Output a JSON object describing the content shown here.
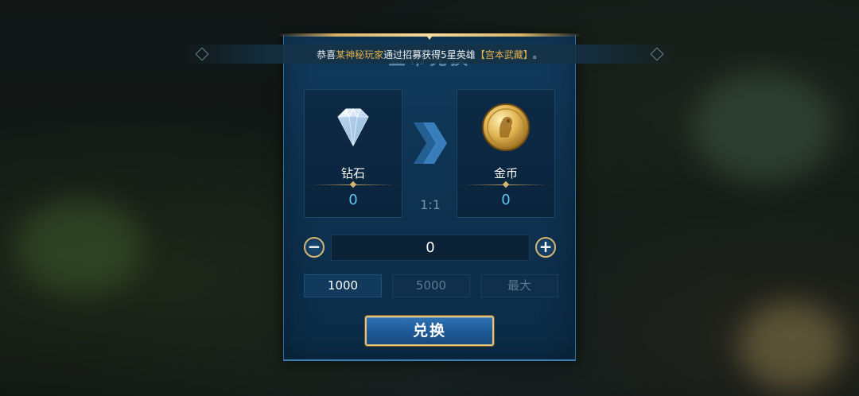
{
  "notice": {
    "prefix": "恭喜",
    "player_name": "某神秘玩家",
    "middle": "通过招募获得5星英雄",
    "hero": "【宫本武藏】",
    "suffix": "。"
  },
  "panel": {
    "title": "金币兑换"
  },
  "from_currency": {
    "icon": "diamond-icon",
    "label": "钻石",
    "amount": "0"
  },
  "to_currency": {
    "icon": "gold-coin-icon",
    "label": "金币",
    "amount": "0"
  },
  "ratio": "1:1",
  "amount_input": {
    "value": "0",
    "minus": "−",
    "plus": "+"
  },
  "presets": [
    {
      "label": "1000",
      "state": "active"
    },
    {
      "label": "5000",
      "state": "disabled"
    },
    {
      "label": "最大",
      "state": "disabled"
    }
  ],
  "exchange_button": "兑换",
  "colors": {
    "accent_gold": "#d6b673",
    "amount_blue": "#5fc8f0",
    "highlight_orange": "#e6b24a",
    "panel_blue": "#0e3352"
  }
}
